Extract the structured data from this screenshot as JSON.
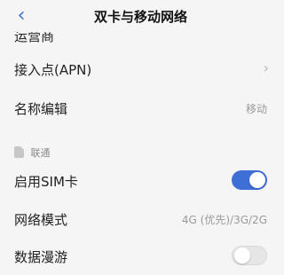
{
  "header": {
    "title": "双卡与移动网络"
  },
  "partial_row": {
    "label": "运营商"
  },
  "rows": {
    "apn": {
      "label": "接入点(APN)"
    },
    "name_edit": {
      "label": "名称编辑",
      "value": "移动"
    }
  },
  "section": {
    "label": "联通"
  },
  "sim_rows": {
    "enable_sim": {
      "label": "启用SIM卡",
      "toggle": "on"
    },
    "network_mode": {
      "label": "网络模式",
      "value": "4G (优先)/3G/2G"
    },
    "roaming": {
      "label": "数据漫游",
      "toggle": "off"
    }
  },
  "colors": {
    "accent": "#3d6fd6",
    "background": "#f5f5f5",
    "muted_text": "#9a9a9a"
  }
}
